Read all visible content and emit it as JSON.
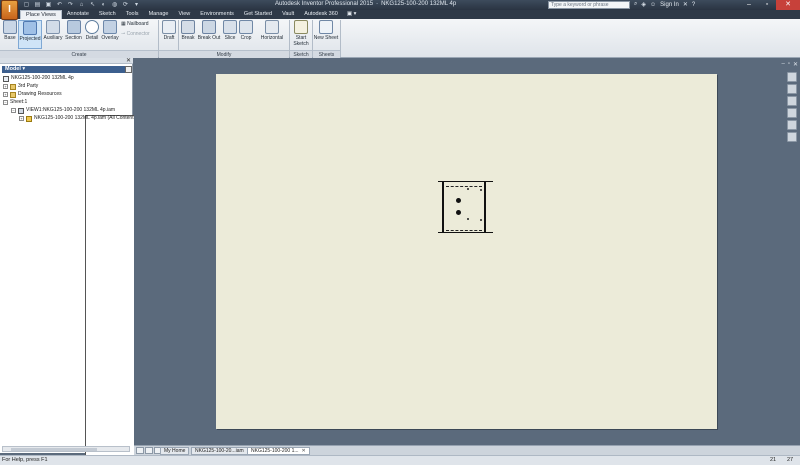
{
  "app": {
    "logo_letter": "I",
    "title": "Autodesk Inventor Professional 2015",
    "document": "NKG125-100-200 132ML 4p",
    "search_placeholder": "Type a keyword or phrase",
    "signin": "Sign In"
  },
  "tabs": [
    "Place Views",
    "Annotate",
    "Sketch",
    "Tools",
    "Manage",
    "View",
    "Environments",
    "Get Started",
    "Vault",
    "Autodesk 360"
  ],
  "active_tab": "Place Views",
  "tab_extra": "▣ ▾",
  "ribbon": {
    "create": {
      "label": "Create",
      "buttons": [
        "Base",
        "Projected",
        "Auxiliary",
        "Section",
        "Detail",
        "Overlay"
      ],
      "nailboard": "Nailboard",
      "connector": "Connector"
    },
    "modify": {
      "label": "Modify",
      "buttons": [
        "Draft",
        "Break",
        "Break Out",
        "Slice",
        "Crop",
        "Horizontal"
      ]
    },
    "sketch": {
      "label": "Sketch",
      "start_line1": "Start",
      "start_line2": "Sketch"
    },
    "sheets": {
      "label": "Sheets",
      "new_sheet": "New Sheet"
    }
  },
  "browser": {
    "header": "Model ▾",
    "tree": [
      {
        "label": "NKG125-100-200 132ML 4p"
      },
      {
        "label": "3rd Party"
      },
      {
        "label": "Drawing Resources"
      },
      {
        "label": "Sheet:1"
      },
      {
        "label": "VIEW1:NKG125-100-200 132ML 4p.iam"
      },
      {
        "label": "NKG125-100-200 132ML 4p.iam (All Content C"
      }
    ]
  },
  "doc_tabs": {
    "home": "My Home",
    "tab1": "NKG125-100-20...iam",
    "tab2": "NKG125-100-200 1..."
  },
  "status": {
    "help": "For Help, press F1",
    "n1": "21",
    "n2": "27"
  },
  "colors": {
    "sheet": "#ecebd9",
    "canvas": "#5b6a7c",
    "ribbon_active": "#cfe4f7"
  }
}
